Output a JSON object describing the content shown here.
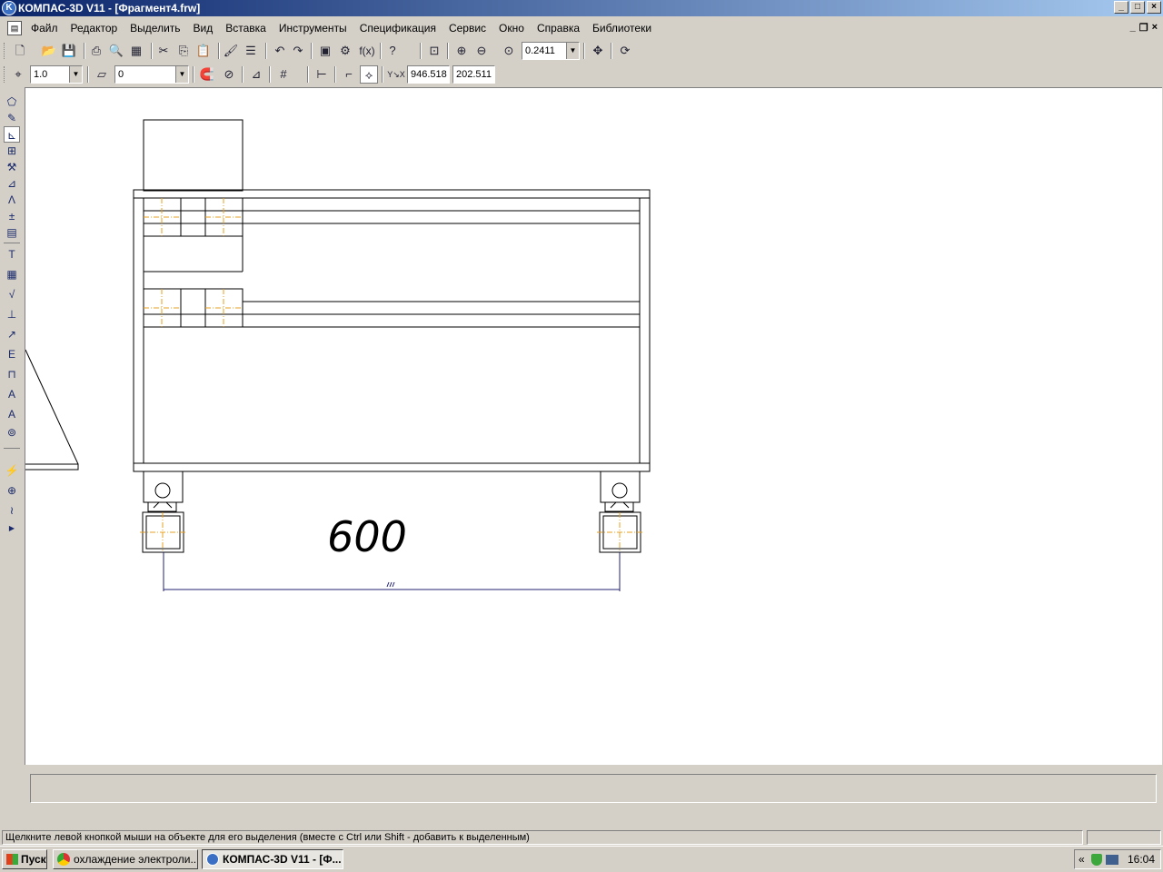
{
  "window": {
    "title": "КОМПАС-3D V11 - [Фрагмент4.frw]",
    "app_icon_letter": "K"
  },
  "menu": [
    "Файл",
    "Редактор",
    "Выделить",
    "Вид",
    "Вставка",
    "Инструменты",
    "Спецификация",
    "Сервис",
    "Окно",
    "Справка",
    "Библиотеки"
  ],
  "toolbar": {
    "zoom_value": "0.2411",
    "function_label": "f(x)",
    "style_scale": "1.0",
    "layer_value": "0",
    "coord_x": "946.518",
    "coord_y": "202.511"
  },
  "drawing": {
    "dimension_text": "600"
  },
  "status": {
    "hint": "Щелкните левой кнопкой мыши на объекте для его выделения (вместе с Ctrl или Shift - добавить к выделенным)"
  },
  "taskbar": {
    "start_label": "Пуск",
    "tasks": [
      {
        "label": "охлаждение электроли..."
      },
      {
        "label": "КОМПАС-3D V11 - [Ф..."
      }
    ],
    "clock": "16:04"
  },
  "colors": {
    "title_bar": "#0a246a",
    "centerline": "#e8a020",
    "dimension": "#202070"
  }
}
